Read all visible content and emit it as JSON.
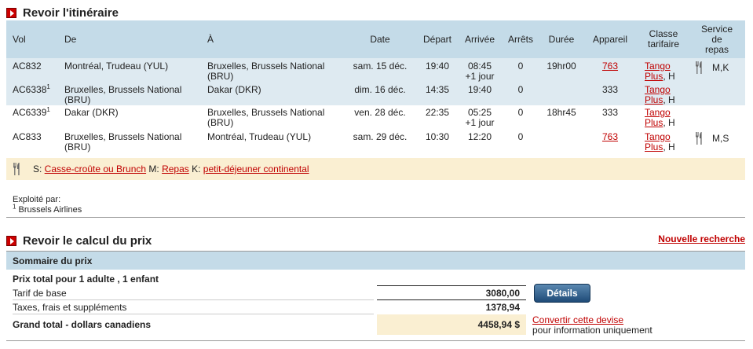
{
  "itinerary": {
    "title": "Revoir l'itinéraire",
    "headers": {
      "vol": "Vol",
      "de": "De",
      "a": "À",
      "date": "Date",
      "depart": "Départ",
      "arrivee": "Arrivée",
      "arrets": "Arrêts",
      "duree": "Durée",
      "appareil": "Appareil",
      "classe1": "Classe",
      "classe2": "tarifaire",
      "service1": "Service",
      "service2": "de",
      "service3": "repas"
    },
    "rows": [
      {
        "vol": "AC832",
        "sup": "",
        "de1": "Montréal, Trudeau (YUL)",
        "de2": "",
        "a1": "Bruxelles, Brussels National",
        "a2": "(BRU)",
        "date": "sam. 15 déc.",
        "depart": "19:40",
        "arr1": "08:45",
        "arr2": "+1 jour",
        "arrets": "0",
        "duree": "19hr00",
        "appareil": "763",
        "classe1": "Tango",
        "classe2": "Plus",
        "classe_suffix": ", H",
        "repas": "M,K"
      },
      {
        "vol": "AC6338",
        "sup": "1",
        "de1": "Bruxelles, Brussels National",
        "de2": "(BRU)",
        "a1": "Dakar (DKR)",
        "a2": "",
        "date": "dim. 16 déc.",
        "depart": "14:35",
        "arr1": "19:40",
        "arr2": "",
        "arrets": "0",
        "duree": "",
        "appareil": "333",
        "classe1": "Tango",
        "classe2": "Plus",
        "classe_suffix": ", H",
        "repas": ""
      },
      {
        "vol": "AC6339",
        "sup": "1",
        "de1": "Dakar (DKR)",
        "de2": "",
        "a1": "Bruxelles, Brussels National",
        "a2": "(BRU)",
        "date": "ven. 28 déc.",
        "depart": "22:35",
        "arr1": "05:25",
        "arr2": "+1 jour",
        "arrets": "0",
        "duree": "18hr45",
        "appareil": "333",
        "classe1": "Tango",
        "classe2": "Plus",
        "classe_suffix": ", H",
        "repas": ""
      },
      {
        "vol": "AC833",
        "sup": "",
        "de1": "Bruxelles, Brussels National",
        "de2": "(BRU)",
        "a1": "Montréal, Trudeau (YUL)",
        "a2": "",
        "date": "sam. 29 déc.",
        "depart": "10:30",
        "arr1": "12:20",
        "arr2": "",
        "arrets": "0",
        "duree": "",
        "appareil": "763",
        "classe1": "Tango",
        "classe2": "Plus",
        "classe_suffix": ", H",
        "repas": "M,S"
      }
    ],
    "legend": {
      "s_prefix": "S: ",
      "s_link": "Casse-croûte ou Brunch",
      "m_prefix": " M: ",
      "m_link": "Repas",
      "k_prefix": " K: ",
      "k_link": "petit-déjeuner continental"
    },
    "operated_by_label": "Exploité par:",
    "operated_by_sup": "1",
    "operated_by_name": " Brussels Airlines"
  },
  "pricing": {
    "title": "Revoir le calcul du prix",
    "new_search": "Nouvelle recherche",
    "summary_title": "Sommaire du prix",
    "passengers": "Prix total pour 1 adulte , 1 enfant",
    "base_fare_label": "Tarif de base",
    "base_fare": "3080,00",
    "taxes_label": "Taxes, frais et suppléments",
    "taxes": "1378,94",
    "grand_total_label": "Grand total - dollars canadiens",
    "grand_total": "4458,94 $",
    "details_button": "Détails",
    "convert_link": "Convertir cette devise",
    "convert_note": "pour information uniquement"
  },
  "colors": {
    "link": "#c00000",
    "header_blue": "#c4dbe8",
    "row_blue": "#deeaf1",
    "legend_bg": "#faefd2"
  },
  "icons": {
    "section": "red-play-arrow-icon",
    "meal": "fork-knife-icon"
  }
}
